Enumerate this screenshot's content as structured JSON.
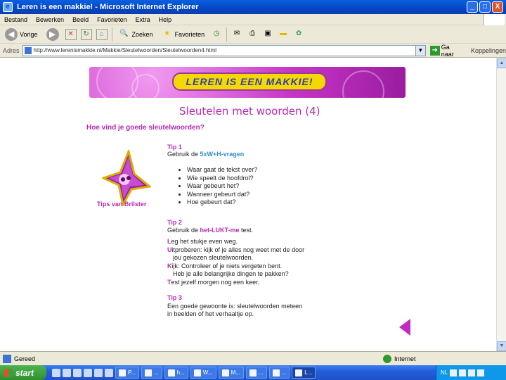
{
  "window": {
    "title": "Leren is een makkie! - Microsoft Internet Explorer",
    "buttons": [
      "_",
      "□",
      "X"
    ]
  },
  "menu": [
    "Bestand",
    "Bewerken",
    "Beeld",
    "Favorieten",
    "Extra",
    "Help"
  ],
  "toolbar": {
    "back_label": "Vorige",
    "search_label": "Zoeken",
    "favorites_label": "Favorieten"
  },
  "address": {
    "label": "Adres",
    "url": "http://www.lerenismakkie.nl/Makkie/Sleutelwoorden/Sleutelwoorden4.html",
    "go_label": "Ga naar",
    "links_label": "Koppelingen"
  },
  "page": {
    "banner_text": "LEREN IS EEN MAKKIE!",
    "heading": "Sleutelen met woorden (4)",
    "question": "Hoe vind je goede sleutelwoorden?",
    "star_caption": "Tips van Brilster",
    "tip1": {
      "title": "Tip 1",
      "text_prefix": "Gebruik de ",
      "text_highlight": "5xW+H-vragen",
      "questions": [
        "Waar gaat de tekst over?",
        "Wie speelt de hoofdrol?",
        "Waar gebeurt het?",
        "Wanneer gebeurt dat?",
        "Hoe gebeurt dat?"
      ]
    },
    "tip2": {
      "title": "Tip 2",
      "text_prefix": "Gebruik de ",
      "text_highlight": "het-LUKT-me",
      "text_suffix": " test.",
      "lines": [
        {
          "letter": "L",
          "text": "eg het stukje even weg."
        },
        {
          "letter": "U",
          "text": "itproberen: kijk of je alles nog weet met de door"
        },
        {
          "letter": "",
          "text": "jou gekozen sleutelwoorden."
        },
        {
          "letter": "K",
          "text": "ijk: Controleer of je niets vergeten bent."
        },
        {
          "letter": "",
          "text": "Heb je alle belangrijke dingen te pakken?"
        },
        {
          "letter": "T",
          "text": "est jezelf morgen nog een keer."
        }
      ]
    },
    "tip3": {
      "title": "Tip 3",
      "line1": "Een goede gewoonte is: sleutelwoorden meteen",
      "line2": "in beelden of het verhaaltje op."
    }
  },
  "status": {
    "text": "Gereed",
    "zone": "Internet"
  },
  "taskbar": {
    "start": "start",
    "tasks": [
      "P...",
      "...",
      "h...",
      "W...",
      "M...",
      "...",
      "...",
      "L..."
    ],
    "tray_lang": "NL"
  },
  "colors": {
    "accent": "#b42ab2",
    "highlight": "#2d8fc9"
  }
}
